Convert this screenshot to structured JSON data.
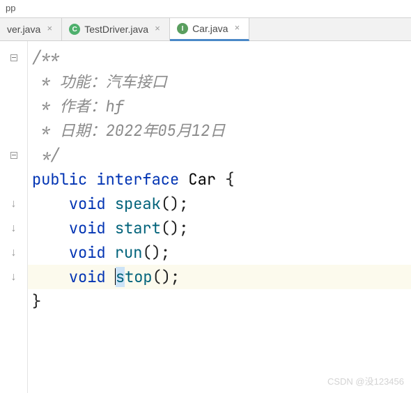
{
  "topFragment": "pp",
  "tabs": [
    {
      "label": "ver.java",
      "iconLetter": "",
      "iconClass": "",
      "active": false
    },
    {
      "label": "TestDriver.java",
      "iconLetter": "C",
      "iconClass": "class-c",
      "active": false
    },
    {
      "label": "Car.java",
      "iconLetter": "I",
      "iconClass": "interface-i",
      "active": true
    }
  ],
  "closeGlyph": "×",
  "code": {
    "lines": [
      {
        "tokens": [
          {
            "t": "/**",
            "c": "comment"
          }
        ]
      },
      {
        "tokens": [
          {
            "t": " * 功能：汽车接口",
            "c": "comment"
          }
        ]
      },
      {
        "tokens": [
          {
            "t": " * 作者：hf",
            "c": "comment"
          }
        ]
      },
      {
        "tokens": [
          {
            "t": " * 日期：2022年05月12日",
            "c": "comment"
          }
        ]
      },
      {
        "tokens": [
          {
            "t": " */",
            "c": "comment"
          }
        ]
      },
      {
        "tokens": [
          {
            "t": "public ",
            "c": "keyword"
          },
          {
            "t": "interface ",
            "c": "keyword"
          },
          {
            "t": "Car ",
            "c": "type"
          },
          {
            "t": "{",
            "c": "punct"
          }
        ]
      },
      {
        "tokens": [
          {
            "t": "    ",
            "c": ""
          },
          {
            "t": "void ",
            "c": "keyword"
          },
          {
            "t": "speak",
            "c": "method"
          },
          {
            "t": "();",
            "c": "punct"
          }
        ]
      },
      {
        "tokens": [
          {
            "t": "    ",
            "c": ""
          },
          {
            "t": "void ",
            "c": "keyword"
          },
          {
            "t": "start",
            "c": "method"
          },
          {
            "t": "();",
            "c": "punct"
          }
        ]
      },
      {
        "tokens": [
          {
            "t": "    ",
            "c": ""
          },
          {
            "t": "void ",
            "c": "keyword"
          },
          {
            "t": "run",
            "c": "method"
          },
          {
            "t": "();",
            "c": "punct"
          }
        ]
      },
      {
        "current": true,
        "tokens": [
          {
            "t": "    ",
            "c": ""
          },
          {
            "t": "void ",
            "c": "keyword"
          },
          {
            "t": "",
            "c": "cursor"
          },
          {
            "t": "s",
            "c": "method sel"
          },
          {
            "t": "top",
            "c": "method"
          },
          {
            "t": "();",
            "c": "punct"
          }
        ]
      },
      {
        "tokens": [
          {
            "t": "}",
            "c": "punct"
          }
        ]
      }
    ]
  },
  "gutterIcons": [
    "fold",
    "",
    "",
    "",
    "fold",
    "",
    "arrow",
    "arrow",
    "arrow",
    "arrow",
    ""
  ],
  "watermark": "CSDN @没123456"
}
